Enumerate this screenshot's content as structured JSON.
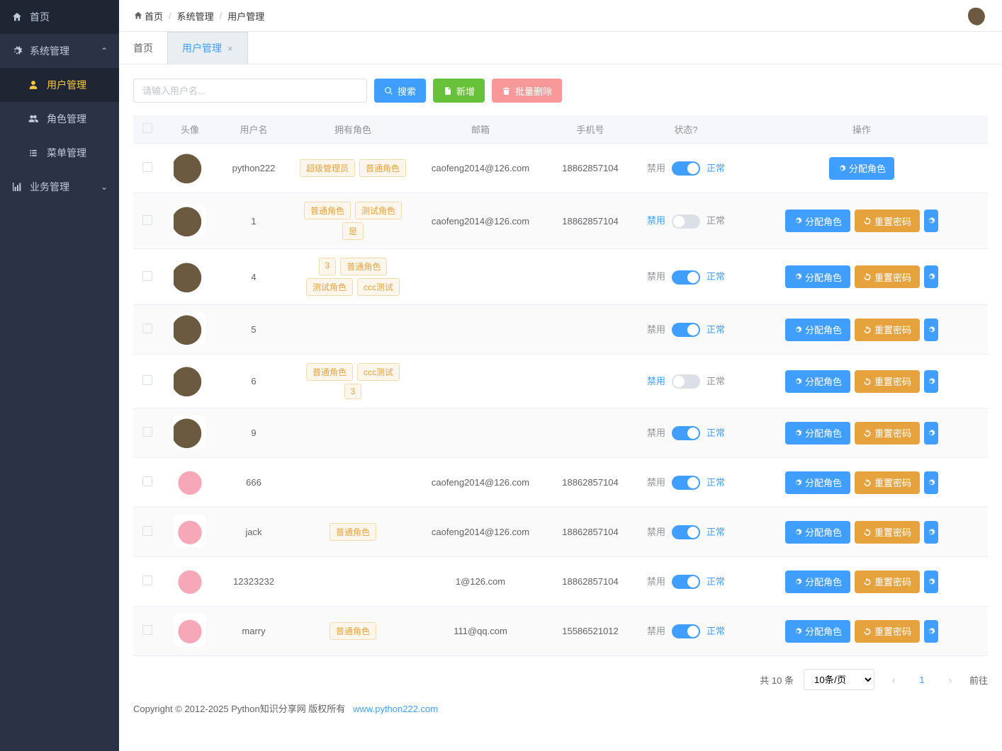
{
  "sidebar": {
    "home": "首页",
    "system": "系统管理",
    "user_mgmt": "用户管理",
    "role_mgmt": "角色管理",
    "menu_mgmt": "菜单管理",
    "business": "业务管理"
  },
  "breadcrumb": {
    "home": "首页",
    "level1": "系统管理",
    "level2": "用户管理"
  },
  "tabs": {
    "home": "首页",
    "current": "用户管理"
  },
  "toolbar": {
    "search_placeholder": "请输入用户名...",
    "search": "搜索",
    "add": "新增",
    "batch_delete": "批量删除"
  },
  "columns": {
    "avatar": "头像",
    "username": "用户名",
    "roles": "拥有角色",
    "email": "邮箱",
    "phone": "手机号",
    "status": "状态?",
    "ops": "操作"
  },
  "status_labels": {
    "disable": "禁用",
    "normal": "正常"
  },
  "op_labels": {
    "assign": "分配角色",
    "reset": "重置密码"
  },
  "rows": [
    {
      "avatar": "boar",
      "username": "python222",
      "roles": [
        "超级管理员",
        "普通角色"
      ],
      "email": "caofeng2014@126.com",
      "phone": "18862857104",
      "on": true,
      "ops": [
        "assign"
      ]
    },
    {
      "avatar": "boar",
      "username": "1",
      "roles": [
        "普通角色",
        "测试角色",
        "是"
      ],
      "email": "caofeng2014@126.com",
      "phone": "18862857104",
      "on": false,
      "ops": [
        "assign",
        "reset",
        "extra"
      ]
    },
    {
      "avatar": "boar",
      "username": "4",
      "roles": [
        "3",
        "普通角色",
        "测试角色",
        "ccc测试"
      ],
      "email": "",
      "phone": "",
      "on": true,
      "ops": [
        "assign",
        "reset",
        "extra"
      ]
    },
    {
      "avatar": "boar",
      "username": "5",
      "roles": [],
      "email": "",
      "phone": "",
      "on": true,
      "ops": [
        "assign",
        "reset",
        "extra"
      ]
    },
    {
      "avatar": "boar",
      "username": "6",
      "roles": [
        "普通角色",
        "ccc测试",
        "3"
      ],
      "email": "",
      "phone": "",
      "on": false,
      "ops": [
        "assign",
        "reset",
        "extra"
      ]
    },
    {
      "avatar": "boar",
      "username": "9",
      "roles": [],
      "email": "",
      "phone": "",
      "on": true,
      "ops": [
        "assign",
        "reset",
        "extra"
      ]
    },
    {
      "avatar": "pig",
      "username": "666",
      "roles": [],
      "email": "caofeng2014@126.com",
      "phone": "18862857104",
      "on": true,
      "ops": [
        "assign",
        "reset",
        "extra"
      ]
    },
    {
      "avatar": "pig",
      "username": "jack",
      "roles": [
        "普通角色"
      ],
      "email": "caofeng2014@126.com",
      "phone": "18862857104",
      "on": true,
      "ops": [
        "assign",
        "reset",
        "extra"
      ]
    },
    {
      "avatar": "pig",
      "username": "12323232",
      "roles": [],
      "email": "1@126.com",
      "phone": "18862857104",
      "on": true,
      "ops": [
        "assign",
        "reset",
        "extra"
      ]
    },
    {
      "avatar": "pig",
      "username": "marry",
      "roles": [
        "普通角色"
      ],
      "email": "111@qq.com",
      "phone": "15586521012",
      "on": true,
      "ops": [
        "assign",
        "reset",
        "extra"
      ]
    }
  ],
  "pagination": {
    "total": "共 10 条",
    "per_page": "10条/页",
    "page": "1",
    "goto": "前往"
  },
  "footer": {
    "text": "Copyright © 2012-2025 Python知识分享网 版权所有",
    "link": "www.python222.com"
  }
}
